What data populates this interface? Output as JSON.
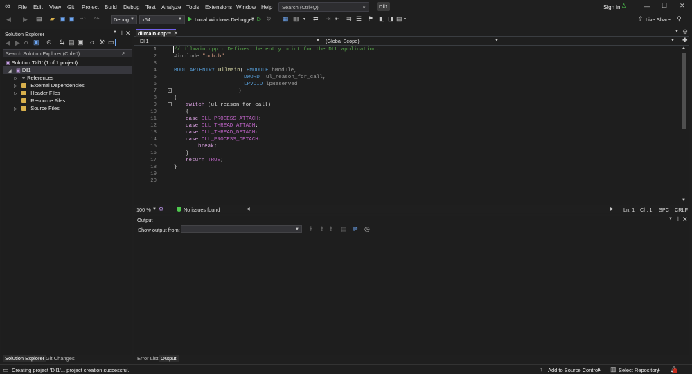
{
  "titlebar": {
    "menus": [
      "File",
      "Edit",
      "View",
      "Git",
      "Project",
      "Build",
      "Debug",
      "Test",
      "Analyze",
      "Tools",
      "Extensions",
      "Window",
      "Help"
    ],
    "search_placeholder": "Search (Ctrl+Q)",
    "solution_badge": "Dll1",
    "sign_in": "Sign in"
  },
  "toolbar": {
    "config": "Debug",
    "platform": "x64",
    "run_label": "Local Windows Debugger",
    "live_share": "Live Share"
  },
  "solution_explorer": {
    "title": "Solution Explorer",
    "search_placeholder": "Search Solution Explorer (Ctrl+ü)",
    "solution": "Solution 'Dll1' (1 of 1 project)",
    "project": "Dll1",
    "items": [
      "References",
      "External Dependencies",
      "Header Files",
      "Resource Files",
      "Source Files"
    ]
  },
  "editor": {
    "tab_label": "dllmain.cpp",
    "nav_project": "Dll1",
    "nav_scope": "(Global Scope)",
    "line_numbers": [
      "1",
      "2",
      "3",
      "4",
      "5",
      "6",
      "7",
      "8",
      "9",
      "10",
      "11",
      "12",
      "13",
      "14",
      "15",
      "16",
      "17",
      "18",
      "19",
      "20"
    ],
    "code": {
      "l1": "// dllmain.cpp : Defines the entry point for the DLL application.",
      "l2_pp": "#include ",
      "l2_str": "\"pch.h\"",
      "l4_a": "BOOL APIENTRY ",
      "l4_fn": "DllMain",
      "l4_b": "( ",
      "l4_ty": "HMODULE",
      "l4_p": " hModule,",
      "l5_ty": "DWORD",
      "l5_p": "  ul_reason_for_call,",
      "l6_ty": "LPVOID",
      "l6_p": " lpReserved",
      "l7": ")",
      "l8": "{",
      "l9_kw": "switch",
      "l9_rest": " (ul_reason_for_call)",
      "l10": "{",
      "case_kw": "case ",
      "l11_m": "DLL_PROCESS_ATTACH",
      "l12_m": "DLL_THREAD_ATTACH",
      "l13_m": "DLL_THREAD_DETACH",
      "l14_m": "DLL_PROCESS_DETACH",
      "colon": ":",
      "l15_kw": "break",
      "semi": ";",
      "l16": "}",
      "l17_kw": "return ",
      "l17_v": "TRUE",
      "l18": "}"
    },
    "zoom": "100 %",
    "issues": "No issues found",
    "ln": "Ln: 1",
    "ch": "Ch: 1",
    "spc": "SPC",
    "crlf": "CRLF"
  },
  "output": {
    "title": "Output",
    "show_from": "Show output from:"
  },
  "bottom_tabs": {
    "sol": "Solution Explorer",
    "git": "Git Changes",
    "errors": "Error List",
    "output": "Output"
  },
  "statusbar": {
    "message": "Creating project 'Dll1'... project creation successful.",
    "source_control": "Add to Source Control",
    "repository": "Select Repository",
    "notifications": "1"
  },
  "colors": {
    "accent": "#7160e8",
    "folder": "#d8b04c",
    "run": "#4ec94e"
  }
}
